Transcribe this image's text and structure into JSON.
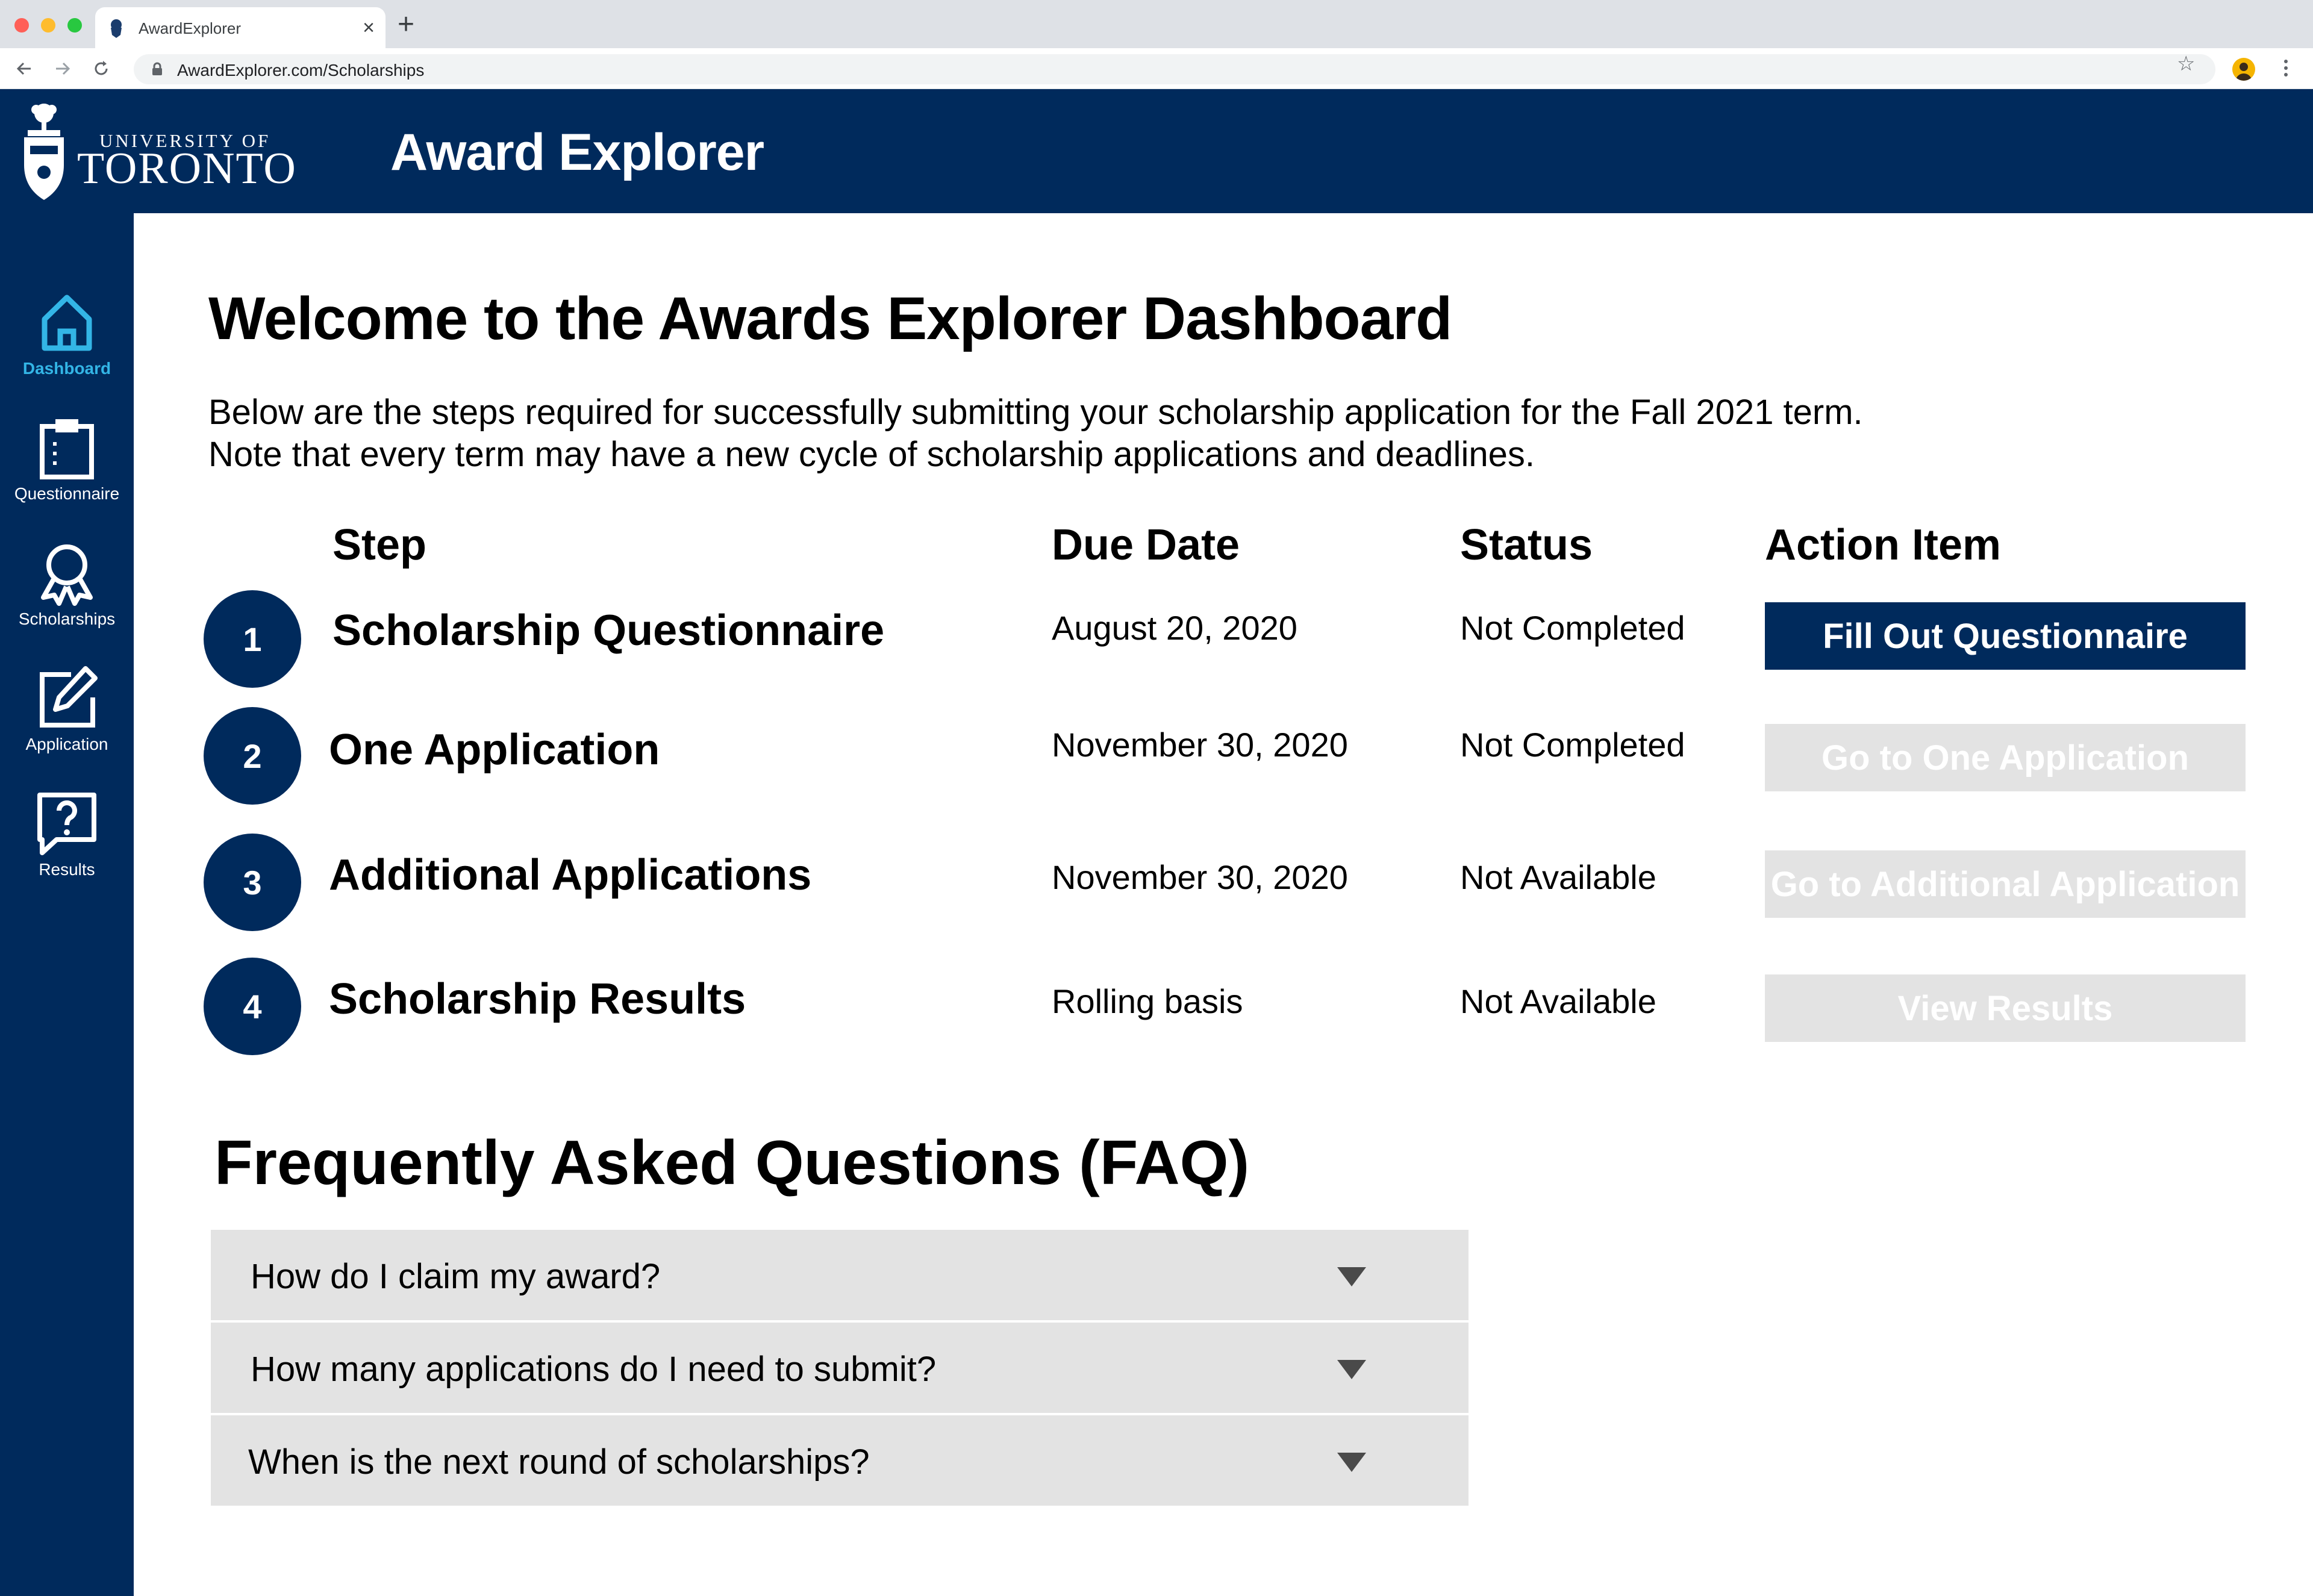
{
  "browser": {
    "tab_title": "AwardExplorer",
    "tab_close": "×",
    "new_tab": "+",
    "url": "AwardExplorer.com/Scholarships",
    "bookmark_star": "☆"
  },
  "header": {
    "university_small": "UNIVERSITY OF",
    "university_big": "TORONTO",
    "app_title": "Award Explorer",
    "brand_color": "#002a5c"
  },
  "sidebar": {
    "active_color": "#33b5e6",
    "items": [
      {
        "label": "Dashboard",
        "icon": "home-icon"
      },
      {
        "label": "Questionnaire",
        "icon": "clipboard-icon"
      },
      {
        "label": "Scholarships",
        "icon": "award-ribbon-icon"
      },
      {
        "label": "Application",
        "icon": "edit-icon"
      },
      {
        "label": "Results",
        "icon": "help-message-icon"
      }
    ]
  },
  "main": {
    "title": "Welcome to the Awards Explorer Dashboard",
    "intro": "Below are the steps required for successfully submitting your scholarship application for the Fall 2021 term. Note that every term may have a new cycle of scholarship applications and deadlines.",
    "columns": {
      "step": "Step",
      "due_date": "Due Date",
      "status": "Status",
      "action": "Action Item"
    },
    "steps": [
      {
        "number": "1",
        "name": "Scholarship Questionnaire",
        "due": "August 20, 2020",
        "status": "Not Completed",
        "action": "Fill Out Questionnaire",
        "enabled": true
      },
      {
        "number": "2",
        "name": "One Application",
        "due": "November 30, 2020",
        "status": "Not Completed",
        "action": "Go to One Application",
        "enabled": false
      },
      {
        "number": "3",
        "name": "Additional Applications",
        "due": "November 30, 2020",
        "status": "Not Available",
        "action": "Go to Additional Application",
        "enabled": false
      },
      {
        "number": "4",
        "name": "Scholarship Results",
        "due": "Rolling basis",
        "status": "Not Available",
        "action": "View Results",
        "enabled": false
      }
    ]
  },
  "faq": {
    "title": "Frequently Asked Questions (FAQ)",
    "items": [
      {
        "question": "How do I claim my award?"
      },
      {
        "question": "How many applications do I need to submit?"
      },
      {
        "question": "When is the next round of scholarships?"
      }
    ]
  }
}
